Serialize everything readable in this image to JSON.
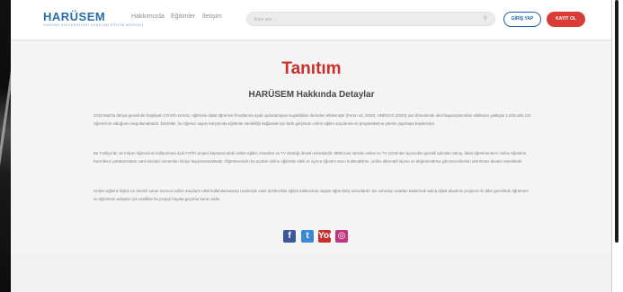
{
  "header": {
    "logo_text": "HARÜSEM",
    "logo_subtitle": "HARRAN ÜNİVERSİTESİ UZAKTAN EĞİTİM MERKEZİ",
    "nav": [
      "Hakkımızda",
      "Eğitimler",
      "İletişim"
    ],
    "search_placeholder": "Kurs ara ...",
    "login_label": "GİRİŞ YAP",
    "register_label": "KAYIT OL"
  },
  "main": {
    "title": "Tanıtım",
    "subtitle": "HARÜSEM Hakkında Detaylar",
    "paragraphs": [
      "2019 Mart'ta dünya genelinde başlayan COVID-19 krizi, eğitimde dijital öğrenme fırsatlarına ayak uyduramayan kuşaklıkları derinden etkilemiştir (Fernn vd, 2020). UNESCO (2020) son döneminde okul kapanışlarından etkilenen yaklaşık 1.543.446.132 öğrencinin olduğunu vurgulamaktadır. Devletler, bu öğrenci sayısı karşısında eğitimde sürekliliği sağlamak için türlü girişimde online eğitim araçlarına ve programlarına yanıtın yapmaya başlamıştır.",
      "Bu Türkiye'de 18 milyon öğrencinin kullanımına açık FATİH projesi kapsamındaki online eğitim ortamları ve TV desteği devam etmektedir. MEB kısa sürede online ve TV çözümleri açısından gerekli adımları atmış, fakat öğretmenlerin online öğretime hazırlıksız yakalanmaları canlı dersleri sunumları ileriye taşıyamamaktadır. Öğretmenlerin bu açıdan online eğitimde etkili ve ayrıca öğretim aracı kullanabilme, online alternatif ölçme ve değerlendirme gibi becerilerinin artırılması devam etmektedir.",
      "Online eğitime ilişkin en önemli sorun mevcut online araçların etkili kullanılamaması nedeniyle canlı derslerdeki eğitim kalitesinde oluşan öğrenilmiş sorunlardır. Bu sorunları ortadan kaldırmak adına dijital akademi projemiz ile ülke genelinde öğretmen ve öğretmen adayları için özellikle bu projeyi hayata geçirme kararı aldık."
    ]
  },
  "social": {
    "facebook_glyph": "f",
    "twitter_glyph": "t",
    "youtube_glyph": "You",
    "instagram_glyph": "◎"
  },
  "colors": {
    "accent_red": "#c9302c",
    "brand_blue": "#1f64a8"
  }
}
